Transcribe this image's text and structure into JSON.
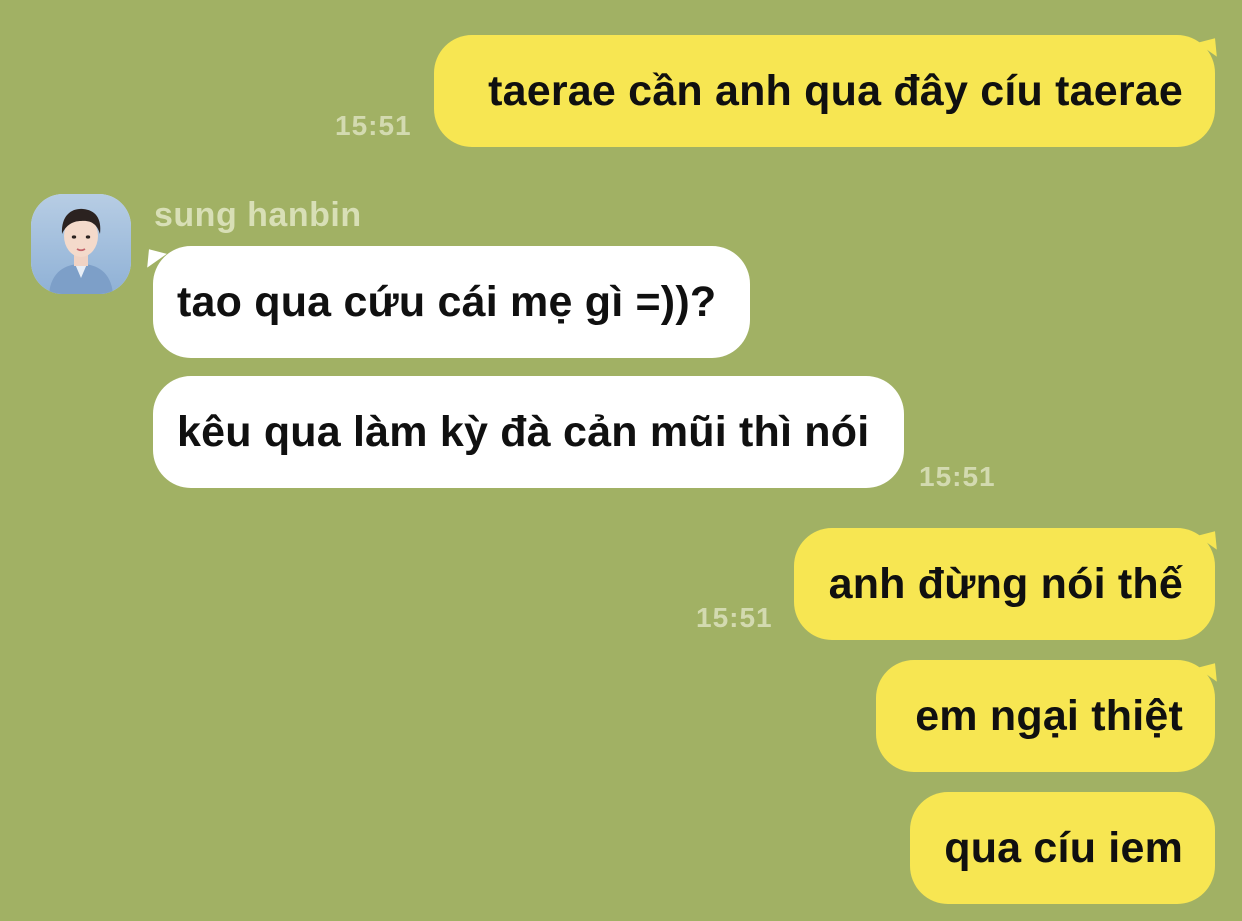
{
  "chat": {
    "contact": {
      "name": "sung hanbin",
      "avatar_icon": "avatar-photo"
    },
    "colors": {
      "background": "#a1b164",
      "outgoing_bubble": "#f7e652",
      "incoming_bubble": "#ffffff",
      "timestamp": "#d3dab0"
    },
    "messages": [
      {
        "direction": "out",
        "text": "taerae cần anh qua đây cíu taerae",
        "time": "15:51"
      },
      {
        "direction": "in",
        "text": "tao qua cứu cái mẹ gì =))?"
      },
      {
        "direction": "in",
        "text": "kêu qua làm kỳ đà cản mũi thì nói",
        "time": "15:51"
      },
      {
        "direction": "out",
        "text": "anh đừng nói thế",
        "time": "15:51"
      },
      {
        "direction": "out",
        "text": "em ngại thiệt"
      },
      {
        "direction": "out",
        "text": "qua cíu iem"
      }
    ]
  }
}
